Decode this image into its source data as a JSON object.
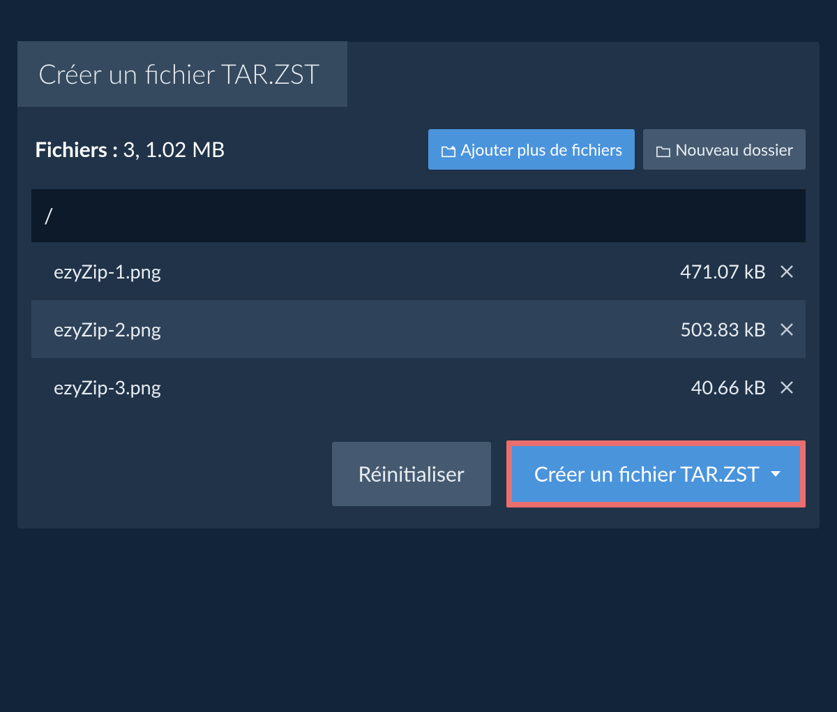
{
  "tab_title": "Créer un fichier TAR.ZST",
  "summary": {
    "label": "Fichiers :",
    "value": "3, 1.02 MB"
  },
  "toolbar": {
    "add_files_label": "Ajouter plus de fichiers",
    "new_folder_label": "Nouveau dossier"
  },
  "path": "/",
  "files": [
    {
      "name": "ezyZip-1.png",
      "size": "471.07 kB"
    },
    {
      "name": "ezyZip-2.png",
      "size": "503.83 kB"
    },
    {
      "name": "ezyZip-3.png",
      "size": "40.66 kB"
    }
  ],
  "actions": {
    "reset_label": "Réinitialiser",
    "create_label": "Créer un fichier TAR.ZST"
  }
}
